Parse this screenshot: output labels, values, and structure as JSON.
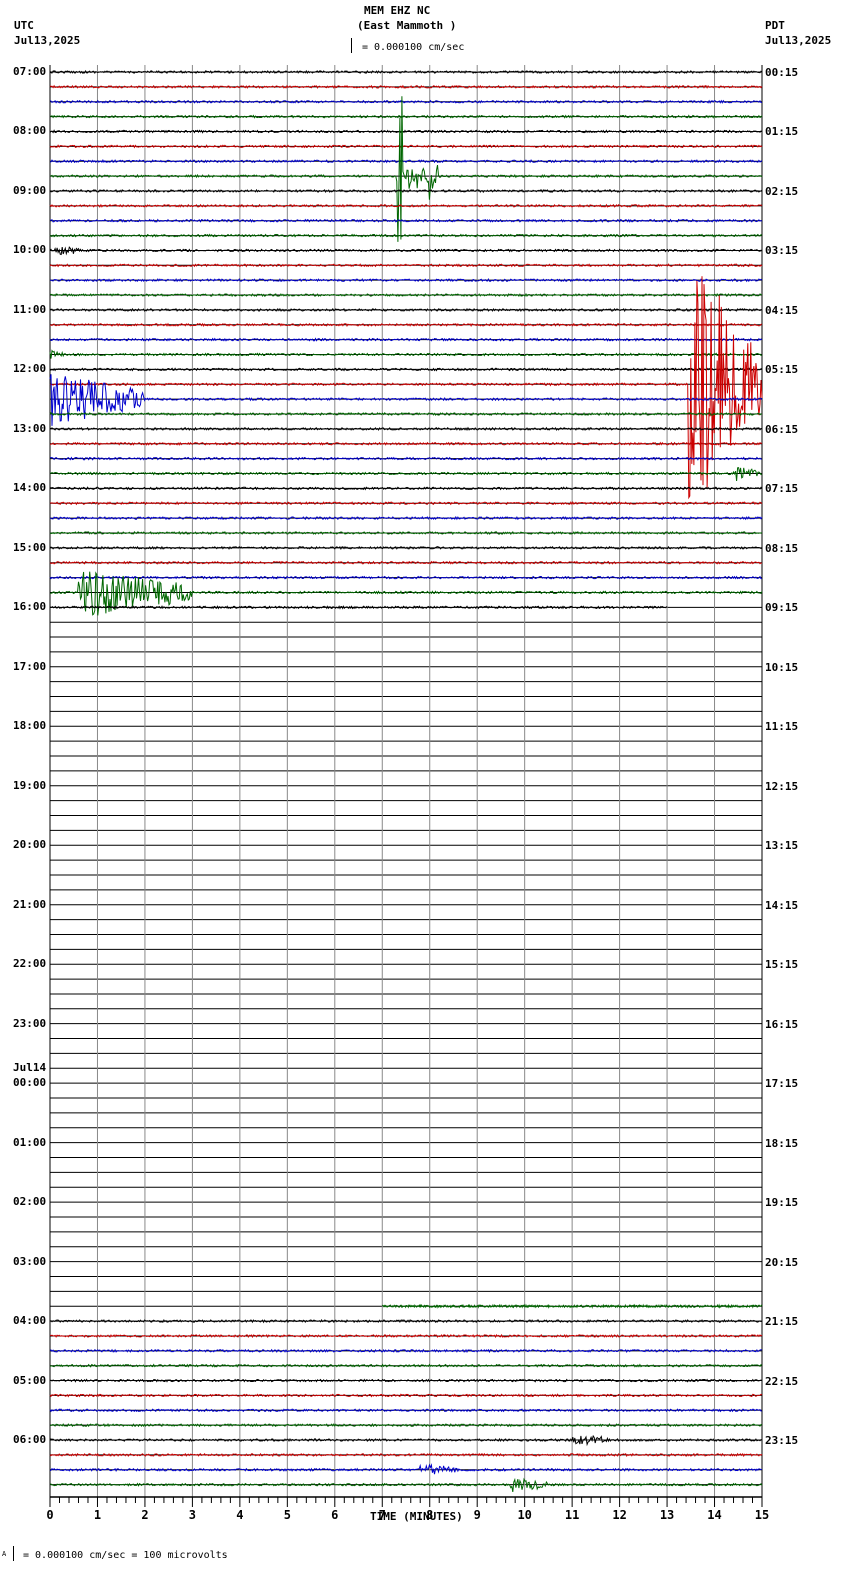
{
  "header": {
    "station": "MEM EHZ NC",
    "location": "(East Mammoth )",
    "left_tz": "UTC",
    "left_date": "Jul13,2025",
    "right_tz": "PDT",
    "right_date": "Jul13,2025",
    "scale_label": "= 0.000100 cm/sec"
  },
  "footer": {
    "scale_label": "= 0.000100 cm/sec =     100 microvolts",
    "prefix": "A"
  },
  "chart_data": {
    "type": "line",
    "title": "MEM EHZ NC (East Mammoth )",
    "xlabel": "TIME (MINUTES)",
    "xlim": [
      0,
      15
    ],
    "x_ticks": [
      "0",
      "1",
      "2",
      "3",
      "4",
      "5",
      "6",
      "7",
      "8",
      "9",
      "10",
      "11",
      "12",
      "13",
      "14",
      "15"
    ],
    "traces_per_hour": 4,
    "total_traces": 96,
    "trace_colors": [
      "#000000",
      "#cc0000",
      "#0000cc",
      "#006600"
    ],
    "utc_labels": [
      "07:00",
      "08:00",
      "09:00",
      "10:00",
      "11:00",
      "12:00",
      "13:00",
      "14:00",
      "15:00",
      "16:00",
      "17:00",
      "18:00",
      "19:00",
      "20:00",
      "21:00",
      "22:00",
      "23:00",
      "00:00",
      "01:00",
      "02:00",
      "03:00",
      "04:00",
      "05:00",
      "06:00"
    ],
    "utc_date_change": {
      "label": "Jul14",
      "hour_index": 17
    },
    "pdt_labels": [
      "00:15",
      "01:15",
      "02:15",
      "03:15",
      "04:15",
      "05:15",
      "06:15",
      "07:15",
      "08:15",
      "09:15",
      "10:15",
      "11:15",
      "12:15",
      "13:15",
      "14:15",
      "15:15",
      "16:15",
      "17:15",
      "18:15",
      "19:15",
      "20:15",
      "21:15",
      "22:15",
      "23:15"
    ],
    "recorded_segments": [
      {
        "from_trace": 0,
        "to_trace": 35,
        "start_min": 0,
        "end_min": 15
      },
      {
        "from_trace": 36,
        "to_trace": 36,
        "start_min": 0,
        "end_min": 13
      },
      {
        "from_trace": 83,
        "to_trace": 83,
        "start_min": 7,
        "end_min": 15
      },
      {
        "from_trace": 84,
        "to_trace": 95,
        "start_min": 0,
        "end_min": 15
      }
    ],
    "events": [
      {
        "trace": 7,
        "start_min": 7.3,
        "end_min": 8.2,
        "amplitude": 5.5,
        "kind": "spike"
      },
      {
        "trace": 12,
        "start_min": 0.1,
        "end_min": 0.6,
        "amplitude": 0.4,
        "kind": "burst"
      },
      {
        "trace": 21,
        "start_min": 13.45,
        "end_min": 15,
        "amplitude": 8.5,
        "kind": "burst"
      },
      {
        "trace": 22,
        "start_min": 0,
        "end_min": 2.0,
        "amplitude": 1.8,
        "kind": "burst"
      },
      {
        "trace": 27,
        "start_min": 14.4,
        "end_min": 15,
        "amplitude": 0.5,
        "kind": "burst"
      },
      {
        "trace": 35,
        "start_min": 0.6,
        "end_min": 3.0,
        "amplitude": 1.8,
        "kind": "burst"
      },
      {
        "trace": 19,
        "start_min": 0,
        "end_min": 0.3,
        "amplitude": 0.4,
        "kind": "burst"
      },
      {
        "trace": 94,
        "start_min": 7.8,
        "end_min": 8.6,
        "amplitude": 0.4,
        "kind": "burst"
      },
      {
        "trace": 95,
        "start_min": 9.7,
        "end_min": 10.5,
        "amplitude": 0.5,
        "kind": "burst"
      },
      {
        "trace": 92,
        "start_min": 11.0,
        "end_min": 11.8,
        "amplitude": 0.4,
        "kind": "burst"
      }
    ]
  }
}
